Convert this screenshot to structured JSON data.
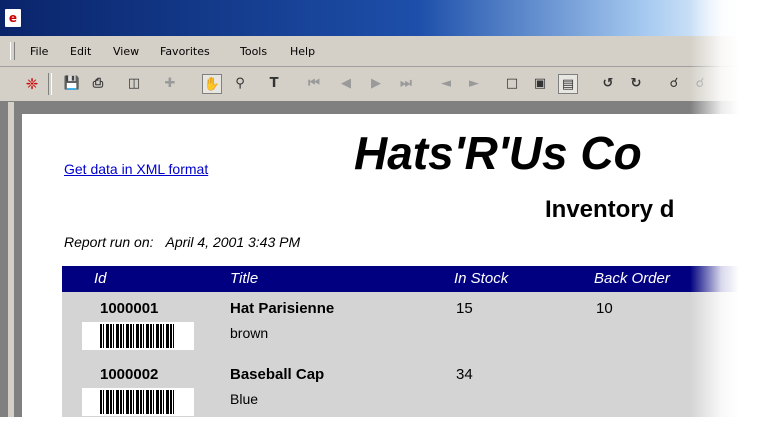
{
  "menu": {
    "items": [
      {
        "label": "File"
      },
      {
        "label": "Edit"
      },
      {
        "label": "View"
      },
      {
        "label": "Favorites"
      },
      {
        "label": "Tools"
      },
      {
        "label": "Help"
      }
    ]
  },
  "toolbar": {
    "icons": [
      "acrobat-icon",
      "save-icon",
      "print-icon",
      "page-view-icon",
      "move-icon",
      "hand-tool-icon",
      "zoom-icon",
      "text-select-icon",
      "first-page-icon",
      "previous-page-icon",
      "next-page-icon",
      "last-page-icon",
      "go-back-icon",
      "go-forward-icon",
      "actual-size-icon",
      "fit-page-icon",
      "fit-width-icon",
      "rotate-left-icon",
      "rotate-right-icon",
      "find-icon",
      "find-again-icon"
    ]
  },
  "report": {
    "xml_link": "Get data in XML format",
    "company": "Hats'R'Us Co",
    "subtitle": "Inventory d",
    "run_label": "Report run on:",
    "run_date": "April 4, 2001 3:43 PM"
  },
  "table": {
    "headers": {
      "id": "Id",
      "title": "Title",
      "in_stock": "In Stock",
      "back_order": "Back Order"
    },
    "rows": [
      {
        "id": "1000001",
        "title": "Hat Parisienne",
        "color": "brown",
        "in_stock": "15",
        "back_order": "10"
      },
      {
        "id": "1000002",
        "title": "Baseball Cap",
        "color": "Blue",
        "in_stock": "34",
        "back_order": ""
      }
    ]
  },
  "colors": {
    "header_bg": "#000080",
    "row_bg": "#d4d4d4",
    "link": "#0000cc",
    "title_bar": "#0a246a"
  }
}
